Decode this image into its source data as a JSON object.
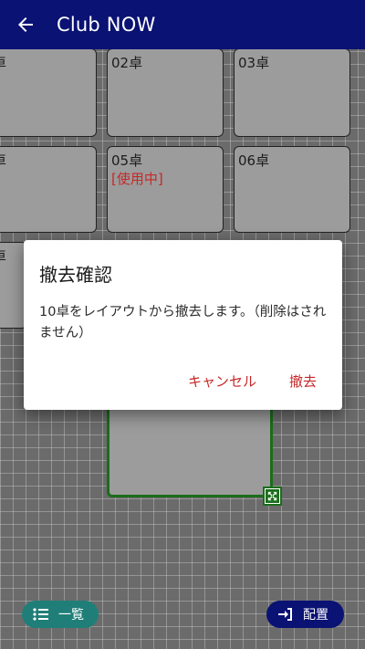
{
  "appbar": {
    "title": "Club NOW",
    "back_icon": "arrow-left-icon"
  },
  "tables": [
    {
      "label": "卓",
      "status": ""
    },
    {
      "label": "02卓",
      "status": ""
    },
    {
      "label": "03卓",
      "status": ""
    },
    {
      "label": "卓",
      "status": ""
    },
    {
      "label": "05卓",
      "status": "[使用中]"
    },
    {
      "label": "06卓",
      "status": ""
    },
    {
      "label": "卓",
      "status": ""
    }
  ],
  "dialog": {
    "title": "撤去確認",
    "message": "10卓をレイアウトから撤去します。（削除はされません）",
    "cancel_label": "キャンセル",
    "remove_label": "撤去"
  },
  "bottom": {
    "list_label": "一覧",
    "layout_label": "配置"
  },
  "colors": {
    "appbar": "#0a1273",
    "accent_red": "#c62828",
    "selection_green": "#1b6d1b",
    "list_pill": "#1f7f78"
  }
}
